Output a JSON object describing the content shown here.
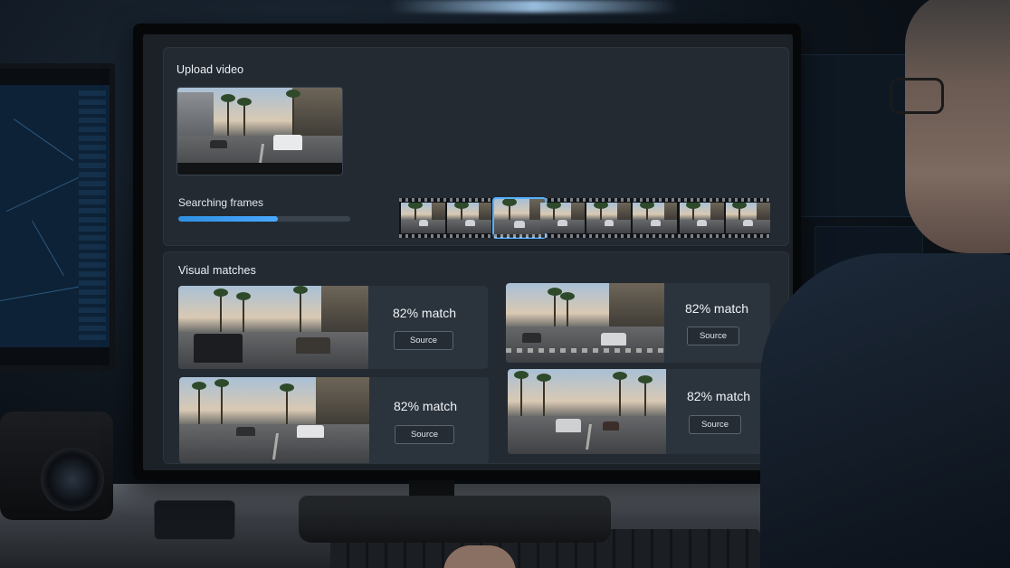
{
  "upload": {
    "title": "Upload video",
    "progress_label": "Searching frames",
    "progress_fraction": 0.58,
    "filmstrip_frame_count": 8,
    "filmstrip_selected_index": 2
  },
  "matches": {
    "title": "Visual matches",
    "items": [
      {
        "match_text": "82% match",
        "button_label": "Source"
      },
      {
        "match_text": "82% match",
        "button_label": "Source"
      },
      {
        "match_text": "82% match",
        "button_label": "Source"
      },
      {
        "match_text": "82% match",
        "button_label": "Source"
      }
    ]
  },
  "colors": {
    "accent": "#4aa8ff",
    "panel": "#232a32",
    "screen_bg": "#1c2128"
  }
}
